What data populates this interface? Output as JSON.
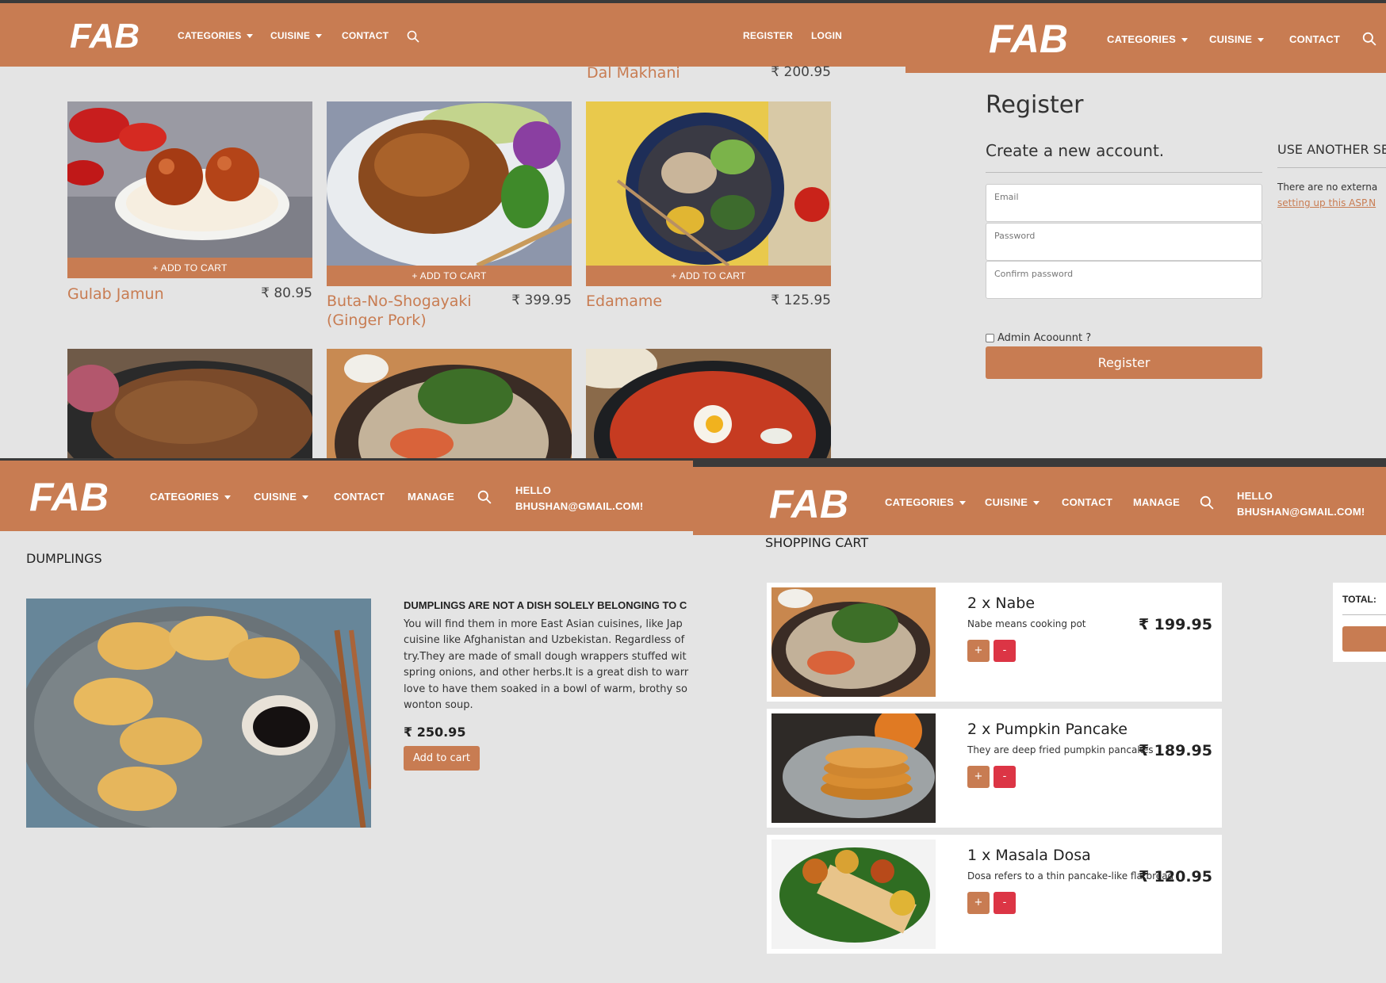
{
  "brand": {
    "logo_text": "FAB"
  },
  "nav": {
    "categories": "CATEGORIES",
    "cuisine": "CUISINE",
    "contact": "CONTACT",
    "manage": "MANAGE",
    "register": "REGISTER",
    "login": "LOGIN",
    "hello": "HELLO",
    "user": "BHUSHAN@GMAIL.COM!"
  },
  "menu_page": {
    "top_partial": {
      "name": "Dal Makhani",
      "price": "₹ 200.95"
    },
    "add_label": "+ ADD TO CART",
    "items": [
      {
        "name": "Gulab Jamun",
        "price": "₹ 80.95"
      },
      {
        "name": "Buta-No-Shogayaki (Ginger Pork)",
        "price": "₹ 399.95"
      },
      {
        "name": "Edamame",
        "price": "₹ 125.95"
      }
    ]
  },
  "register_page": {
    "title": "Register",
    "subtitle": "Create a new account.",
    "email_label": "Email",
    "password_label": "Password",
    "confirm_label": "Confirm password",
    "admin_label": "Admin Acoounnt ?",
    "button": "Register",
    "external_heading": "USE ANOTHER SE",
    "external_text": "There are no externa",
    "external_link": "setting up this ASP.N"
  },
  "dish_page": {
    "title": "DUMPLINGS",
    "heading": "DUMPLINGS ARE NOT A DISH SOLELY BELONGING TO C",
    "lines": [
      "You will find them in more East Asian cuisines, like Jap",
      "cuisine like Afghanistan and Uzbekistan. Regardless of",
      "try.They are made of small dough wrappers stuffed wit",
      "spring onions, and other herbs.It is a great dish to warr",
      "love to have them soaked in a bowl of warm, brothy so",
      "wonton soup."
    ],
    "price": "₹ 250.95",
    "button": "Add to cart"
  },
  "cart_page": {
    "title": "SHOPPING CART",
    "total_label": "TOTAL:",
    "plus": "+",
    "minus": "-",
    "items": [
      {
        "name": "2 x Nabe",
        "desc": "Nabe means cooking pot",
        "price": "₹ 199.95"
      },
      {
        "name": "2 x Pumpkin Pancake",
        "desc": "They are deep fried pumpkin pancakes",
        "price": "₹ 189.95"
      },
      {
        "name": "1 x Masala Dosa",
        "desc": "Dosa refers to a thin pancake-like flatbread",
        "price": "₹ 120.95"
      }
    ]
  },
  "colors": {
    "brand": "#c87c52",
    "danger": "#dc3545",
    "background": "#e4e4e4"
  }
}
